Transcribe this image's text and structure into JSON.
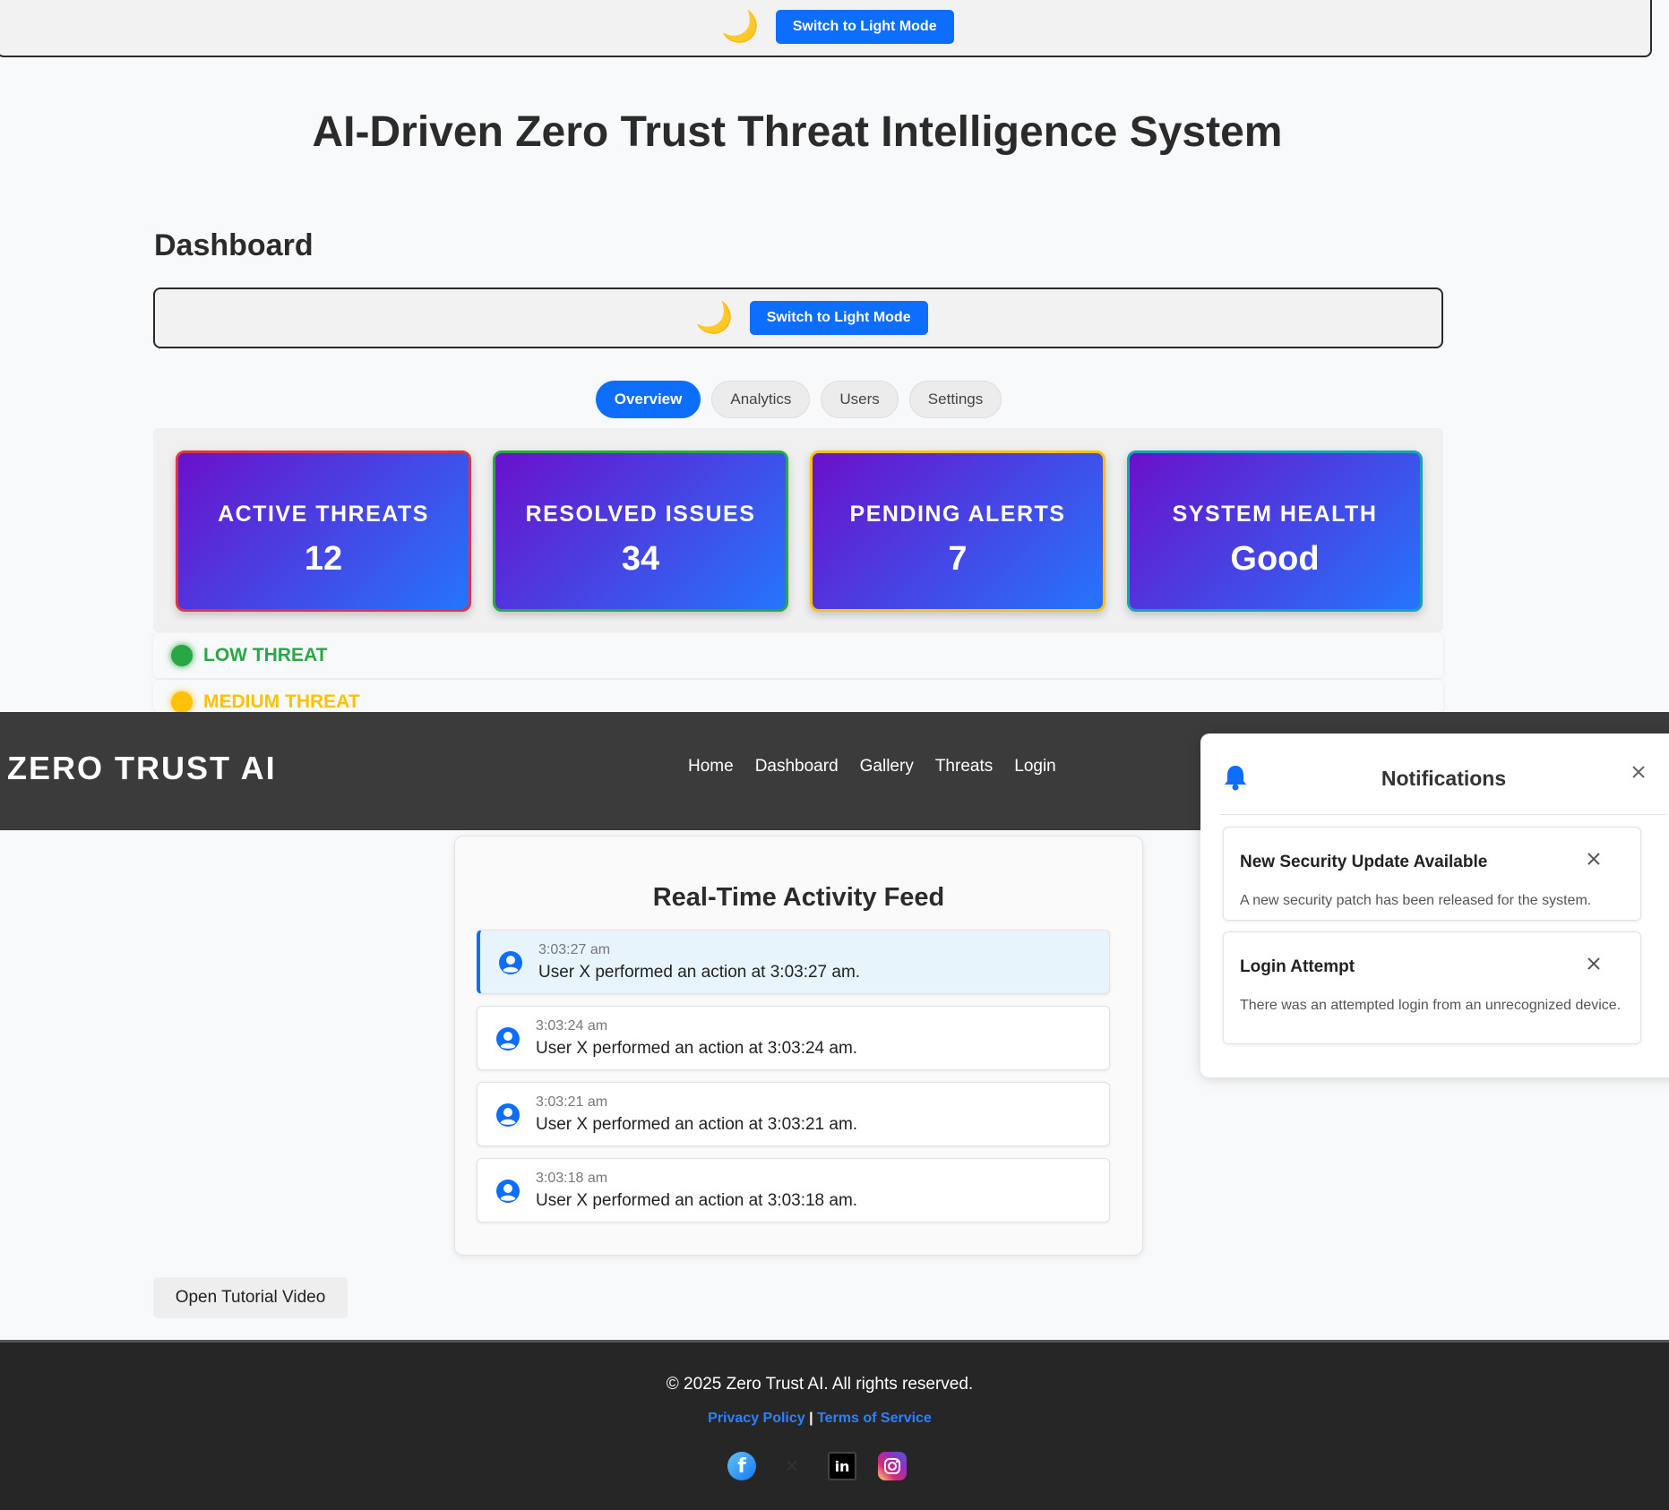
{
  "top_bar": {
    "moon_icon": "moon-icon",
    "mode_button": "Switch to Light Mode"
  },
  "page_title": "AI-Driven Zero Trust Threat Intelligence System",
  "dashboard": {
    "title": "Dashboard",
    "mode_button": "Switch to Light Mode",
    "tabs": [
      {
        "label": "Overview",
        "active": true
      },
      {
        "label": "Analytics",
        "active": false
      },
      {
        "label": "Users",
        "active": false
      },
      {
        "label": "Settings",
        "active": false
      }
    ],
    "stats": [
      {
        "label": "ACTIVE THREATS",
        "value": "12",
        "border": "#dc3545"
      },
      {
        "label": "RESOLVED ISSUES",
        "value": "34",
        "border": "#28a745"
      },
      {
        "label": "PENDING ALERTS",
        "value": "7",
        "border": "#ffc107"
      },
      {
        "label": "SYSTEM HEALTH",
        "value": "Good",
        "border": "#17a2b8"
      }
    ],
    "threat_levels": [
      {
        "label": "LOW THREAT",
        "color": "#28a745"
      },
      {
        "label": "MEDIUM THREAT",
        "color": "#ffc107"
      }
    ]
  },
  "navbar": {
    "brand": "ZERO TRUST AI",
    "links": [
      "Home",
      "Dashboard",
      "Gallery",
      "Threats",
      "Login"
    ]
  },
  "notifications": {
    "title": "Notifications",
    "items": [
      {
        "title": "New Security Update Available",
        "body": "A new security patch has been released for the system."
      },
      {
        "title": "Login Attempt",
        "body": "There was an attempted login from an unrecognized device."
      }
    ]
  },
  "activity_feed": {
    "title": "Real-Time Activity Feed",
    "items": [
      {
        "time": "3:03:27 am",
        "text": "User X performed an action at 3:03:27 am."
      },
      {
        "time": "3:03:24 am",
        "text": "User X performed an action at 3:03:24 am."
      },
      {
        "time": "3:03:21 am",
        "text": "User X performed an action at 3:03:21 am."
      },
      {
        "time": "3:03:18 am",
        "text": "User X performed an action at 3:03:18 am."
      }
    ]
  },
  "tutorial_button": "Open Tutorial Video",
  "footer": {
    "copyright": "© 2025 Zero Trust AI. All rights reserved.",
    "privacy": "Privacy Policy",
    "separator": "|",
    "terms": "Terms of Service",
    "socials": [
      "facebook-icon",
      "x-icon",
      "linkedin-icon",
      "instagram-icon"
    ]
  },
  "colors": {
    "accent": "#0d6efd",
    "navbar": "#3b3b3b",
    "footer": "#262626"
  }
}
